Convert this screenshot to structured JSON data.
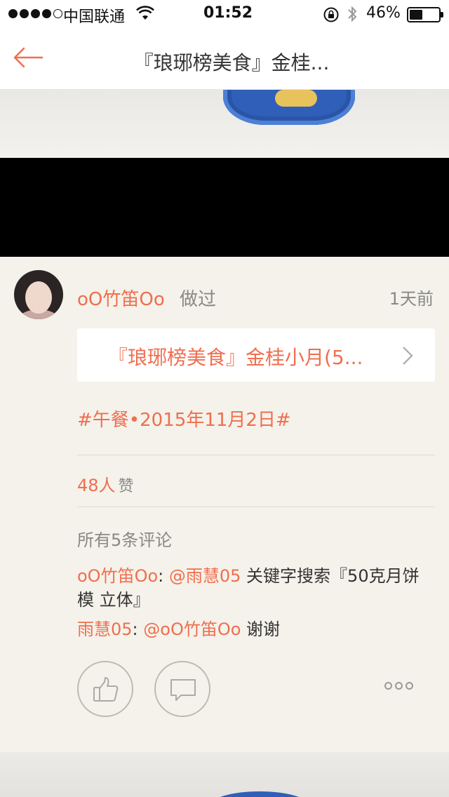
{
  "status_bar": {
    "carrier": "中国联通",
    "time": "01:52",
    "battery_percent_text": "46%",
    "battery_level": 0.46,
    "signal_bars_filled": 4,
    "signal_bars_total": 5
  },
  "nav": {
    "title": "『琅琊榜美食』金桂...",
    "back_icon": "arrow-left-icon",
    "accent_color": "#f06e4f"
  },
  "post": {
    "username": "oO竹笛Oo",
    "action_label": "做过",
    "time_ago": "1天前",
    "recipe_link_text": "『琅琊榜美食』金桂小月(5...",
    "hashtag": "#午餐•2015年11月2日#",
    "likes_count": "48人",
    "likes_label": "赞",
    "comments_header": "所有5条评论"
  },
  "comments": [
    {
      "author": "oO竹笛Oo",
      "separator": ": ",
      "mention": "@雨慧05",
      "text": " 关键字搜索『50克月饼模 立体』"
    },
    {
      "author": "雨慧05",
      "separator": ": ",
      "mention": "@oO竹笛Oo",
      "text": " 谢谢"
    }
  ],
  "actions": {
    "like_icon": "thumbs-up-icon",
    "comment_icon": "speech-bubble-icon",
    "more_icon": "more-dots-icon"
  }
}
